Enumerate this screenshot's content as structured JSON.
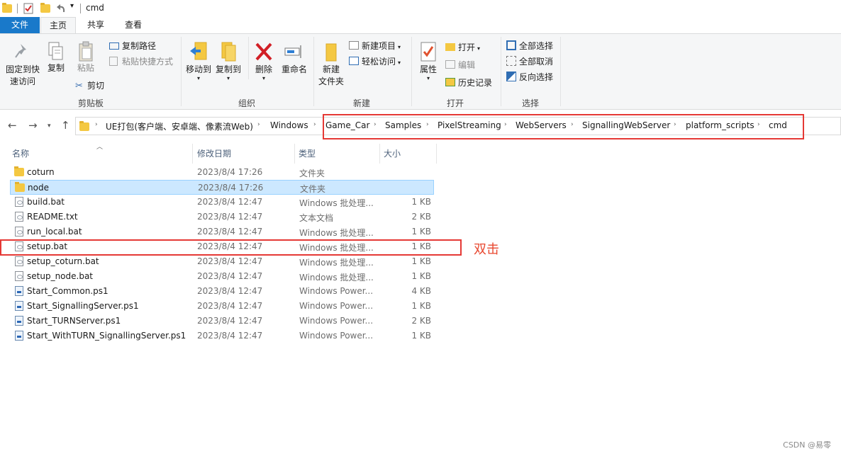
{
  "window": {
    "title": "cmd"
  },
  "ribbon_tabs": {
    "file": "文件",
    "home": "主页",
    "share": "共享",
    "view": "查看"
  },
  "ribbon": {
    "clipboard": {
      "pin_line1": "固定到快",
      "pin_line2": "速访问",
      "copy": "复制",
      "paste": "粘贴",
      "copy_path": "复制路径",
      "paste_shortcut": "粘贴快捷方式",
      "cut": "剪切",
      "label": "剪贴板"
    },
    "organize": {
      "move_to": "移动到",
      "copy_to": "复制到",
      "delete": "删除",
      "rename": "重命名",
      "label": "组织"
    },
    "new": {
      "new_folder_line1": "新建",
      "new_folder_line2": "文件夹",
      "new_item": "新建项目",
      "easy_access": "轻松访问",
      "label": "新建"
    },
    "open": {
      "properties": "属性",
      "open": "打开",
      "edit": "编辑",
      "history": "历史记录",
      "label": "打开"
    },
    "select": {
      "select_all": "全部选择",
      "select_none": "全部取消",
      "invert": "反向选择",
      "label": "选择"
    }
  },
  "breadcrumbs": [
    "UE打包(客户端、安卓端、像素流Web)",
    "Windows",
    "Game_Car",
    "Samples",
    "PixelStreaming",
    "WebServers",
    "SignallingWebServer",
    "platform_scripts",
    "cmd"
  ],
  "columns": {
    "name": "名称",
    "date": "修改日期",
    "type": "类型",
    "size": "大小"
  },
  "files": [
    {
      "name": "coturn",
      "date": "2023/8/4 17:26",
      "type": "文件夹",
      "size": "",
      "icon": "folder-icon"
    },
    {
      "name": "node",
      "date": "2023/8/4 17:26",
      "type": "文件夹",
      "size": "",
      "icon": "folder-icon"
    },
    {
      "name": "build.bat",
      "date": "2023/8/4 12:47",
      "type": "Windows 批处理...",
      "size": "1 KB",
      "icon": "batch-file-icon"
    },
    {
      "name": "README.txt",
      "date": "2023/8/4 12:47",
      "type": "文本文档",
      "size": "2 KB",
      "icon": "text-file-icon"
    },
    {
      "name": "run_local.bat",
      "date": "2023/8/4 12:47",
      "type": "Windows 批处理...",
      "size": "1 KB",
      "icon": "batch-file-icon"
    },
    {
      "name": "setup.bat",
      "date": "2023/8/4 12:47",
      "type": "Windows 批处理...",
      "size": "1 KB",
      "icon": "batch-file-icon"
    },
    {
      "name": "setup_coturn.bat",
      "date": "2023/8/4 12:47",
      "type": "Windows 批处理...",
      "size": "1 KB",
      "icon": "batch-file-icon"
    },
    {
      "name": "setup_node.bat",
      "date": "2023/8/4 12:47",
      "type": "Windows 批处理...",
      "size": "1 KB",
      "icon": "batch-file-icon"
    },
    {
      "name": "Start_Common.ps1",
      "date": "2023/8/4 12:47",
      "type": "Windows Power...",
      "size": "4 KB",
      "icon": "powershell-file-icon"
    },
    {
      "name": "Start_SignallingServer.ps1",
      "date": "2023/8/4 12:47",
      "type": "Windows Power...",
      "size": "1 KB",
      "icon": "powershell-file-icon"
    },
    {
      "name": "Start_TURNServer.ps1",
      "date": "2023/8/4 12:47",
      "type": "Windows Power...",
      "size": "2 KB",
      "icon": "powershell-file-icon"
    },
    {
      "name": "Start_WithTURN_SignallingServer.ps1",
      "date": "2023/8/4 12:47",
      "type": "Windows Power...",
      "size": "1 KB",
      "icon": "powershell-file-icon"
    }
  ],
  "annotation": {
    "text": "双击",
    "color": "#e8472f"
  },
  "watermark": "CSDN @易零",
  "colors": {
    "accent": "#1979ca",
    "selection": "#cce8ff",
    "highlight_box": "#e53935"
  }
}
